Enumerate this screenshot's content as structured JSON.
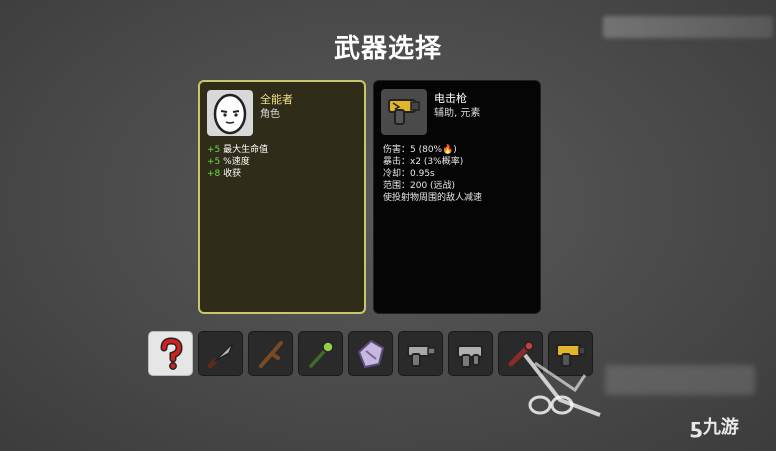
{
  "title": "武器选择",
  "character": {
    "name": "全能者",
    "type": "角色",
    "stats": [
      {
        "value": "+5",
        "label": "最大生命值"
      },
      {
        "value": "+5",
        "label": "%速度"
      },
      {
        "value": "+8",
        "label": "收获"
      }
    ]
  },
  "weapon": {
    "name": "电击枪",
    "tags": "辅助, 元素",
    "stats": [
      "伤害：5 (80%🔥)",
      "暴击：x2 (3%概率)",
      "冷却：0.95s",
      "范围：200 (远战)",
      "使投射物周围的敌人减速"
    ]
  },
  "slots": [
    {
      "icon": "question-mark-icon",
      "selected": true
    },
    {
      "icon": "knife-icon",
      "selected": false
    },
    {
      "icon": "stick-icon",
      "selected": false
    },
    {
      "icon": "spiked-staff-icon",
      "selected": false
    },
    {
      "icon": "shield-shard-icon",
      "selected": false
    },
    {
      "icon": "gray-gun-icon",
      "selected": false
    },
    {
      "icon": "gray-gun-2-icon",
      "selected": false
    },
    {
      "icon": "red-tool-icon",
      "selected": false
    },
    {
      "icon": "taser-icon",
      "selected": false
    }
  ],
  "logo": "九游"
}
